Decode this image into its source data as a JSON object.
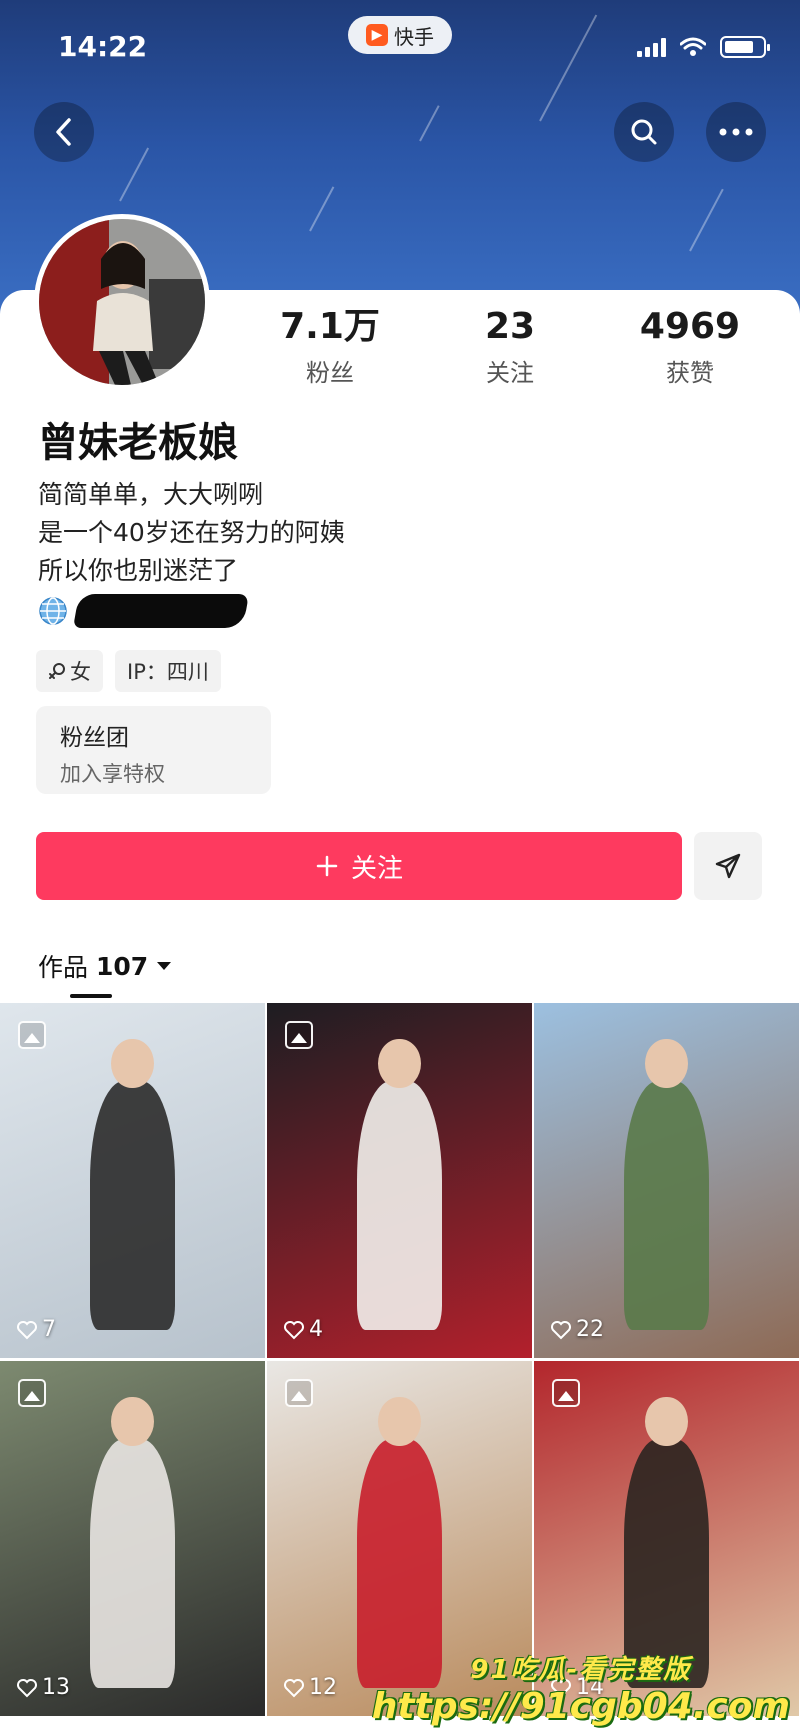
{
  "status_bar": {
    "time": "14:22",
    "app_name": "快手"
  },
  "profile": {
    "nickname": "曾妹老板娘",
    "stats": [
      {
        "value": "7.1万",
        "label": "粉丝"
      },
      {
        "value": "23",
        "label": "关注"
      },
      {
        "value": "4969",
        "label": "获赞"
      }
    ],
    "bio_lines": [
      "简简单单，大大咧咧",
      "是一个40岁还在努力的阿姨",
      "所以你也别迷茫了"
    ],
    "tags": [
      {
        "icon": "female-icon",
        "label": "女"
      },
      {
        "icon": "",
        "label": "IP：四川"
      }
    ],
    "fan_club": {
      "title": "粉丝团",
      "subtitle": "加入享特权"
    },
    "follow_label": "关注"
  },
  "works": {
    "label": "作品",
    "count": "107",
    "items": [
      {
        "likes": "7",
        "colors": [
          "#dfe6ec",
          "#2b2b2b",
          "#b7c2cc"
        ]
      },
      {
        "likes": "4",
        "colors": [
          "#1d1d22",
          "#f2f0ec",
          "#b3202c"
        ]
      },
      {
        "likes": "22",
        "colors": [
          "#9cc0e0",
          "#5a7a4a",
          "#8e6a55"
        ]
      },
      {
        "likes": "13",
        "colors": [
          "#7d8a70",
          "#e9e6e2",
          "#2a2a2a"
        ]
      },
      {
        "likes": "12",
        "colors": [
          "#e9e7e4",
          "#c81f2c",
          "#b98a5c"
        ]
      },
      {
        "likes": "14",
        "colors": [
          "#b3262c",
          "#2b2520",
          "#e0c9a8"
        ]
      }
    ]
  },
  "watermark": {
    "line1": "91吃瓜-看完整版",
    "line2": "https://91cgb04.com"
  }
}
